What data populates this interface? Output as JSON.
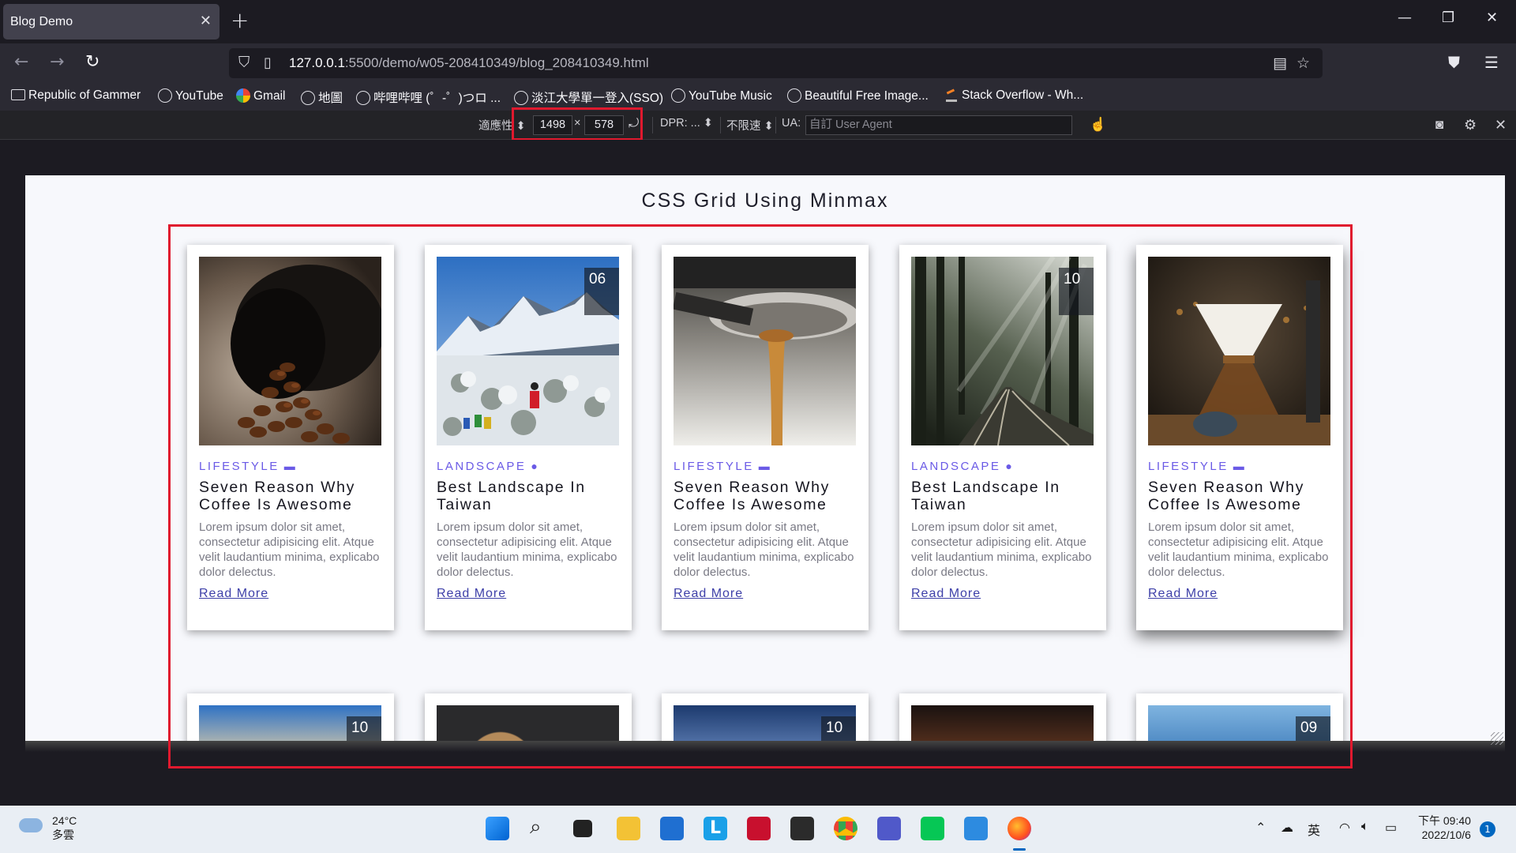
{
  "browser": {
    "tab_title": "Blog Demo",
    "tab_close": "✕",
    "new_tab": "+",
    "url_host": "127.0.0.1",
    "url_rest": ":5500/demo/w05-208410349/blog_208410349.html",
    "bookmarks": [
      "Republic of Gammer",
      "YouTube",
      "Gmail",
      "地圖",
      "哔哩哔哩 (゜-゜)つロ ...",
      "淡江大學單一登入(SSO)",
      "YouTube Music",
      "Beautiful Free Image...",
      "Stack Overflow - Wh..."
    ]
  },
  "rdm": {
    "device": "適應性",
    "width": "1498",
    "times": "×",
    "height": "578",
    "dpr": "DPR: ...",
    "throttle": "不限速",
    "ua_label": "UA:",
    "ua_placeholder": "自訂 User Agent"
  },
  "page": {
    "title": "CSS Grid Using Minmax",
    "cards": [
      {
        "category": "LIFESTYLE",
        "icon": "mug-icon",
        "title": "Seven Reason Why Coffee Is Awesome",
        "text": "Lorem ipsum dolor sit amet, consectetur adipisicing elit. Atque velit laudantium minima, explicabo dolor delectus.",
        "link": "Read More",
        "image": "coffee-beans"
      },
      {
        "category": "LANDSCAPE",
        "icon": "map-pin-icon",
        "title": "Best Landscape In Taiwan",
        "text": "Lorem ipsum dolor sit amet, consectetur adipisicing elit. Atque velit laudantium minima, explicabo dolor delectus.",
        "link": "Read More",
        "image": "snow-mountain",
        "badge": "06"
      },
      {
        "category": "LIFESTYLE",
        "icon": "mug-icon",
        "title": "Seven Reason Why Coffee Is Awesome",
        "text": "Lorem ipsum dolor sit amet, consectetur adipisicing elit. Atque velit laudantium minima, explicabo dolor delectus.",
        "link": "Read More",
        "image": "espresso"
      },
      {
        "category": "LANDSCAPE",
        "icon": "map-pin-icon",
        "title": "Best Landscape In Taiwan",
        "text": "Lorem ipsum dolor sit amet, consectetur adipisicing elit. Atque velit laudantium minima, explicabo dolor delectus.",
        "link": "Read More",
        "image": "forest-rail",
        "badge": "10"
      },
      {
        "category": "LIFESTYLE",
        "icon": "mug-icon",
        "title": "Seven Reason Why Coffee Is Awesome",
        "text": "Lorem ipsum dolor sit amet, consectetur adipisicing elit. Atque velit laudantium minima, explicabo dolor delectus.",
        "link": "Read More",
        "image": "chemex"
      }
    ],
    "row2_badges": [
      "10",
      "",
      "10",
      "",
      "09"
    ]
  },
  "taskbar": {
    "temp": "24°C",
    "weather": "多雲",
    "ime": "英",
    "time": "下午 09:40",
    "date": "2022/10/6",
    "notifications": "1"
  },
  "colors": {
    "accent": "#6a5ae6",
    "link": "#3d3fa8",
    "highlight": "#e0192e"
  }
}
